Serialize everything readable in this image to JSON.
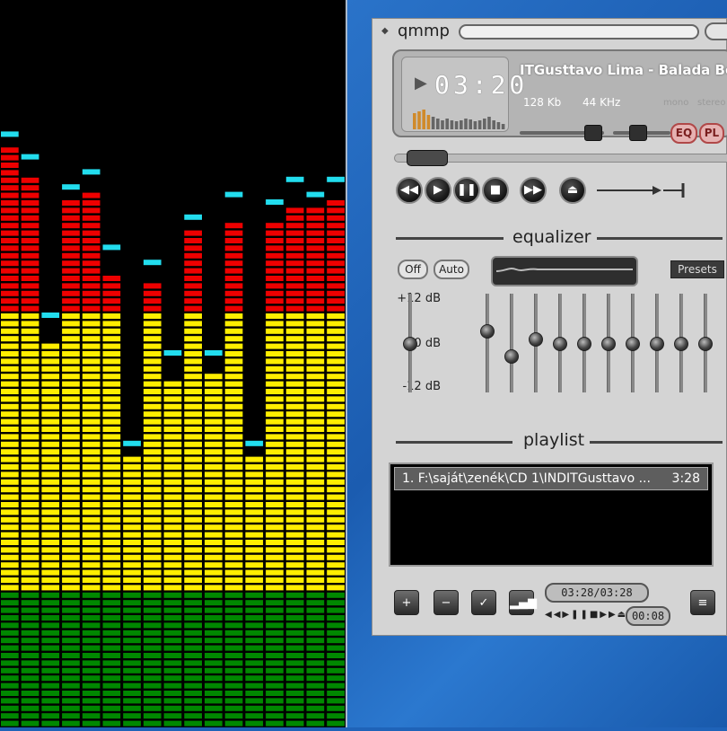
{
  "app": {
    "title": "qmmp"
  },
  "display": {
    "time": "03:20",
    "song": "ITGusttavo Lima - Balada Boa (C",
    "bitrate": "128 Kb",
    "samplerate": "44 KHz",
    "mono": "mono",
    "stereo": "stereo",
    "eq_label": "EQ",
    "pl_label": "PL"
  },
  "transport": {
    "buttons": [
      "previous",
      "play",
      "pause",
      "stop",
      "next",
      "eject"
    ]
  },
  "equalizer": {
    "title": "equalizer",
    "off_label": "Off",
    "auto_label": "Auto",
    "presets_label": "Presets",
    "db_labels": [
      "+12 dB",
      "0 dB",
      "-12 dB"
    ],
    "preamp_level_db": 0,
    "bands_db": [
      3,
      -3,
      1,
      0,
      0,
      0,
      0,
      0,
      0,
      0
    ]
  },
  "playlist": {
    "title": "playlist",
    "items": [
      {
        "title": "1. F:\\saját\\zenék\\CD 1\\INDITGusttavo ...",
        "duration": "3:28"
      }
    ],
    "time_display": "03:28/03:28",
    "elapsed": "00:08"
  },
  "analyzer": {
    "colors": {
      "green": "#008800",
      "yellow": "#ffee00",
      "red": "#ee0000",
      "peak": "#22ddee"
    },
    "levels": [
      0.8,
      0.76,
      0.53,
      0.73,
      0.74,
      0.63,
      0.38,
      0.61,
      0.48,
      0.69,
      0.49,
      0.7,
      0.38,
      0.7,
      0.72,
      0.72,
      0.73
    ]
  }
}
